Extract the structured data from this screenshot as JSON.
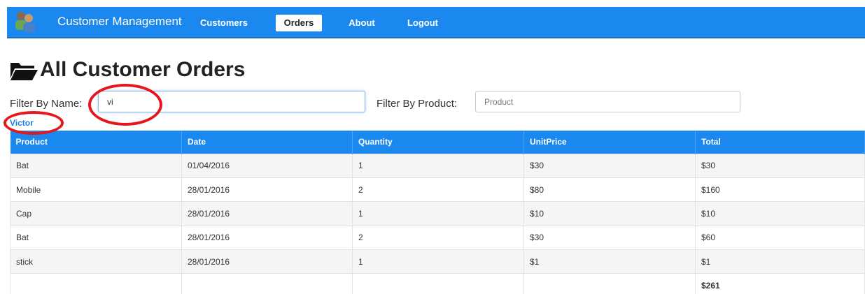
{
  "navbar": {
    "brand": "Customer Management",
    "items": [
      {
        "label": "Customers",
        "active": false
      },
      {
        "label": "Orders",
        "active": true
      },
      {
        "label": "About",
        "active": false
      },
      {
        "label": "Logout",
        "active": false
      }
    ],
    "color": "#1a88ee"
  },
  "page": {
    "title": "All Customer Orders",
    "title_icon": "folder-open-icon"
  },
  "filters": {
    "name_label": "Filter By Name:",
    "name_value": "vi",
    "product_label": "Filter By Product:",
    "product_placeholder": "Product",
    "suggestion": "Victor"
  },
  "table": {
    "columns": [
      "Product",
      "Date",
      "Quantity",
      "UnitPrice",
      "Total"
    ],
    "rows": [
      [
        "Bat",
        "01/04/2016",
        "1",
        "$30",
        "$30"
      ],
      [
        "Mobile",
        "28/01/2016",
        "2",
        "$80",
        "$160"
      ],
      [
        "Cap",
        "28/01/2016",
        "1",
        "$10",
        "$10"
      ],
      [
        "Bat",
        "28/01/2016",
        "2",
        "$30",
        "$60"
      ],
      [
        "stick",
        "28/01/2016",
        "1",
        "$1",
        "$1"
      ]
    ],
    "grand_total": "$261"
  },
  "annotation_color": "#e5161d"
}
